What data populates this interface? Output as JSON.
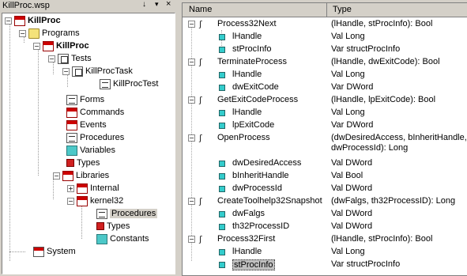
{
  "workspace": {
    "title": "KillProc.wsp",
    "pin_glyph": "↓",
    "dropdown_glyph": "▾",
    "close_glyph": "×"
  },
  "tree": {
    "items": [
      {
        "label": "KillProc",
        "icon": "project-icon"
      },
      {
        "label": "Programs",
        "icon": "folder-icon"
      },
      {
        "label": "KillProc",
        "icon": "program-icon"
      },
      {
        "label": "Tests",
        "icon": "tests-icon"
      },
      {
        "label": "KillProcTask",
        "icon": "task-icon"
      },
      {
        "label": "KillProcTest",
        "icon": "test-icon"
      },
      {
        "label": "Forms",
        "icon": "forms-icon"
      },
      {
        "label": "Commands",
        "icon": "commands-icon"
      },
      {
        "label": "Events",
        "icon": "events-icon"
      },
      {
        "label": "Procedures",
        "icon": "procedures-icon"
      },
      {
        "label": "Variables",
        "icon": "variables-icon"
      },
      {
        "label": "Types",
        "icon": "types-icon"
      },
      {
        "label": "Libraries",
        "icon": "libraries-icon"
      },
      {
        "label": "Internal",
        "icon": "internal-library-icon"
      },
      {
        "label": "kernel32",
        "icon": "dll-icon"
      },
      {
        "label": "Procedures",
        "icon": "procedures-icon"
      },
      {
        "label": "Types",
        "icon": "types-icon"
      },
      {
        "label": "Constants",
        "icon": "constants-icon"
      },
      {
        "label": "System",
        "icon": "system-icon"
      }
    ]
  },
  "grid": {
    "columns": {
      "name": "Name",
      "type": "Type"
    },
    "rows": [
      {
        "name": "Process32Next",
        "type": "(lHandle, stProcInfo): Bool"
      },
      {
        "name": "lHandle",
        "type": "Val Long"
      },
      {
        "name": "stProcInfo",
        "type": "Var structProcInfo"
      },
      {
        "name": "TerminateProcess",
        "type": "(lHandle, dwExitCode): Bool"
      },
      {
        "name": "lHandle",
        "type": "Val Long"
      },
      {
        "name": "dwExitCode",
        "type": "Var DWord"
      },
      {
        "name": "GetExitCodeProcess",
        "type": "(lHandle, lpExitCode): Bool"
      },
      {
        "name": "lHandle",
        "type": "Val Long"
      },
      {
        "name": "lpExitCode",
        "type": "Var DWord"
      },
      {
        "name": "OpenProcess",
        "type": "(dwDesiredAccess, bInheritHandle,\ndwProcessId): Long"
      },
      {
        "name": "dwDesiredAccess",
        "type": "Val DWord"
      },
      {
        "name": "bInheritHandle",
        "type": "Val Bool"
      },
      {
        "name": "dwProcessId",
        "type": "Val DWord"
      },
      {
        "name": "CreateToolhelp32Snapshot",
        "type": "(dwFalgs, th32ProcessID): Long"
      },
      {
        "name": "dwFalgs",
        "type": "Val DWord"
      },
      {
        "name": "th32ProcessID",
        "type": "Val DWord"
      },
      {
        "name": "Process32First",
        "type": "(lHandle, stProcInfo): Bool"
      },
      {
        "name": "lHandle",
        "type": "Val Long"
      },
      {
        "name": "stProcInfo",
        "type": "Var structProcInfo"
      }
    ]
  }
}
